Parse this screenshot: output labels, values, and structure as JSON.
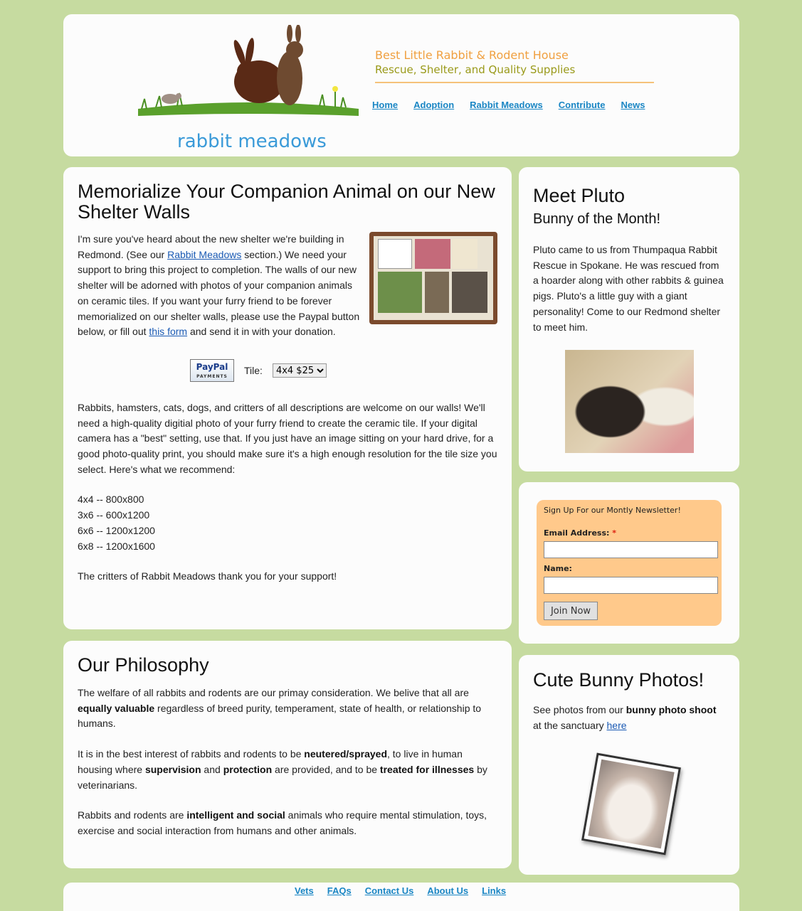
{
  "header": {
    "logo_text": "rabbit meadows",
    "title_line1": "Best Little Rabbit & Rodent House",
    "title_line2": "Rescue, Shelter, and Quality Supplies",
    "nav": [
      "Home",
      "Adoption",
      "Rabbit Meadows",
      "Contribute",
      "News"
    ]
  },
  "memorial": {
    "heading": "Memorialize Your Companion Animal on our New Shelter Walls",
    "intro_part1": "I'm sure you've heard about the new shelter we're building in Redmond. (See our ",
    "intro_link1": "Rabbit Meadows",
    "intro_part2": " section.) We need your support to bring this project to completion. The walls of our new shelter will be adorned with photos of your companion animals on ceramic tiles. If you want your furry friend to be forever memorialized on our shelter walls, please use the Paypal button below, or fill out ",
    "intro_link2": "this form",
    "intro_part3": " and send it in with your donation.",
    "paypal_label": "PayPal",
    "paypal_sub": "PAYMENTS",
    "tile_label": "Tile:",
    "tile_selected": "4x4 $25",
    "para2": "Rabbits, hamsters, cats, dogs, and critters of all descriptions are welcome on our walls! We'll need a high-quality digitial photo of your furry friend to create the ceramic tile. If your digital camera has a \"best\" setting, use that. If you just have an image sitting on your hard drive, for a good photo-quality print, you should make sure it's a high enough resolution for the tile size you select. Here's what we recommend:",
    "sizes": [
      "4x4 -- 800x800",
      "3x6 -- 600x1200",
      "6x6 -- 1200x1200",
      "6x8 -- 1200x1600"
    ],
    "thanks": "The critters of Rabbit Meadows thank you for your support!"
  },
  "philosophy": {
    "heading": "Our Philosophy",
    "p1_a": "The welfare of all rabbits and rodents are our primay consideration. We belive that all are ",
    "p1_b": "equally valuable",
    "p1_c": " regardless of breed purity, temperament, state of health, or relationship to humans.",
    "p2_a": "It is in the best interest of rabbits and rodents to be ",
    "p2_b": "neutered/sprayed",
    "p2_c": ", to live in human housing where ",
    "p2_d": "supervision",
    "p2_e": " and ",
    "p2_f": "protection",
    "p2_g": " are provided, and to be ",
    "p2_h": "treated for illnesses",
    "p2_i": " by veterinarians.",
    "p3_a": "Rabbits and rodents are ",
    "p3_b": "intelligent and social",
    "p3_c": " animals who require mental stimulation, toys, exercise and social interaction from humans and other animals."
  },
  "pluto": {
    "heading": "Meet Pluto",
    "subheading": "Bunny of the Month!",
    "text": "Pluto came to us from Thumpaqua Rabbit Rescue in Spokane. He was rescued from a hoarder along with other rabbits & guinea pigs. Pluto's a little guy with a giant personality! Come to our Redmond shelter to meet him."
  },
  "newsletter": {
    "title": "Sign Up For our Montly Newsletter!",
    "email_label": "Email Address:",
    "required_mark": "*",
    "name_label": "Name:",
    "button": "Join Now"
  },
  "photos": {
    "heading": "Cute Bunny Photos!",
    "text_a": "See photos from our ",
    "text_b": "bunny photo shoot",
    "text_c": " at the sanctuary ",
    "link": "here"
  },
  "footer": {
    "nav": [
      "Vets",
      "FAQs",
      "Contact Us",
      "About Us",
      "Links"
    ]
  }
}
